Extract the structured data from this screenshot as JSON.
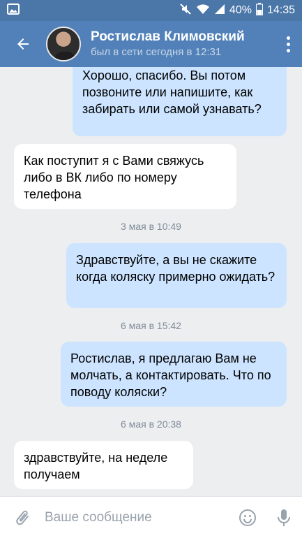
{
  "status": {
    "battery": "40%",
    "time": "14:35"
  },
  "header": {
    "name": "Ростислав Климовский",
    "presence": "был в сети сегодня в 12:31"
  },
  "messages": [
    {
      "dir": "out",
      "text": "Хорошо, спасибо. Вы потом позвоните или напишите, как забирать или самой узнавать?"
    },
    {
      "dir": "in",
      "text": "Как поступит я с Вами свяжусь либо в ВК либо по номеру телефона"
    },
    {
      "date": "3 мая в 10:49"
    },
    {
      "dir": "out",
      "text": "Здравствуйте, а вы не скажите когда коляску примерно ожидать?"
    },
    {
      "date": "6 мая в 15:42"
    },
    {
      "dir": "out",
      "text": "Ростислав, я предлагаю Вам не молчать, а контактировать. Что по поводу коляски?"
    },
    {
      "date": "6 мая в 20:38"
    },
    {
      "dir": "in",
      "text": "здравствуйте, на неделе получаем"
    }
  ],
  "composer": {
    "placeholder": "Ваше сообщение"
  },
  "colors": {
    "header": "#5181b8",
    "statusbar": "#4a76a8",
    "outgoing": "#cce4ff",
    "incoming": "#ffffff",
    "background": "#edeef0"
  }
}
